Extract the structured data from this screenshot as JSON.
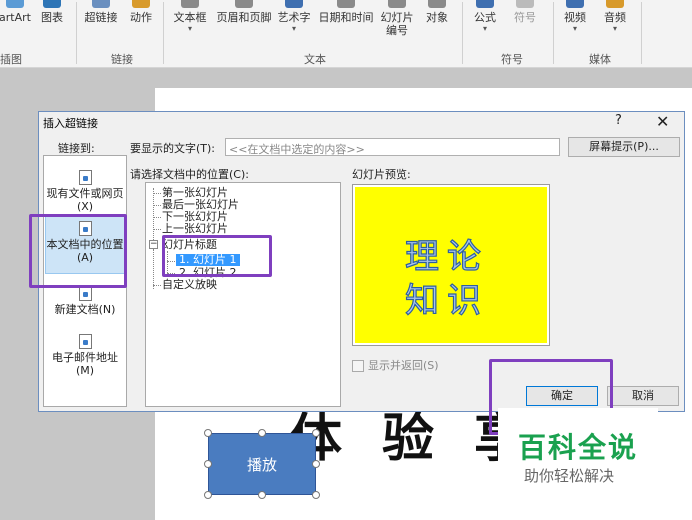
{
  "ribbon": {
    "buttons": [
      {
        "label": "artArt",
        "icon": "smartart-icon"
      },
      {
        "label": "图表",
        "icon": "chart-icon"
      },
      {
        "label": "超链接",
        "icon": "hyperlink-icon"
      },
      {
        "label": "动作",
        "icon": "action-icon"
      },
      {
        "label": "文本框",
        "icon": "textbox-icon"
      },
      {
        "label": "页眉和页脚",
        "icon": "header-footer-icon"
      },
      {
        "label": "艺术字",
        "icon": "wordart-icon"
      },
      {
        "label": "日期和时间",
        "icon": "date-time-icon"
      },
      {
        "label": "幻灯片",
        "label2": "编号",
        "icon": "slide-number-icon"
      },
      {
        "label": "对象",
        "icon": "object-icon"
      },
      {
        "label": "公式",
        "icon": "equation-icon"
      },
      {
        "label": "符号",
        "icon": "symbol-icon"
      },
      {
        "label": "视频",
        "icon": "video-icon"
      },
      {
        "label": "音频",
        "icon": "audio-icon"
      }
    ],
    "groups": [
      "插图",
      "链接",
      "文本",
      "符号",
      "媒体"
    ]
  },
  "slide": {
    "play_button": "播放",
    "big_text": "体验享"
  },
  "dialog": {
    "title": "插入超链接",
    "help": "?",
    "close": "✕",
    "link_to_label": "链接到:",
    "nav": [
      {
        "label": "现有文件或网页(X)"
      },
      {
        "label": "本文档中的位置(A)"
      },
      {
        "label": "新建文档(N)"
      },
      {
        "label": "电子邮件地址(M)"
      }
    ],
    "text_to_display_label": "要显示的文字(T):",
    "text_to_display_value": "<<在文档中选定的内容>>",
    "screentip_button": "屏幕提示(P)...",
    "place_label": "请选择文档中的位置(C):",
    "tree": {
      "items": [
        "第一张幻灯片",
        "最后一张幻灯片",
        "下一张幻灯片",
        "上一张幻灯片",
        "幻灯片标题"
      ],
      "children": [
        "1. 幻灯片 1",
        "2. 幻灯片 2"
      ],
      "custom_show": "自定义放映",
      "expander": "−"
    },
    "preview_label": "幻灯片预览:",
    "preview": {
      "line1": "理论",
      "line2": "知识",
      "bg": "#ffff00"
    },
    "show_return_label": "显示并返回(S)",
    "ok_button": "确定",
    "cancel_button": "取消"
  },
  "watermark": {
    "title": "百科全说",
    "subtitle": "助你轻松解决"
  },
  "colors": {
    "highlight": "#7f3fbf",
    "selection": "#3399ff",
    "preview_bg": "#ffff00",
    "watermark_green": "#1aa14f"
  }
}
